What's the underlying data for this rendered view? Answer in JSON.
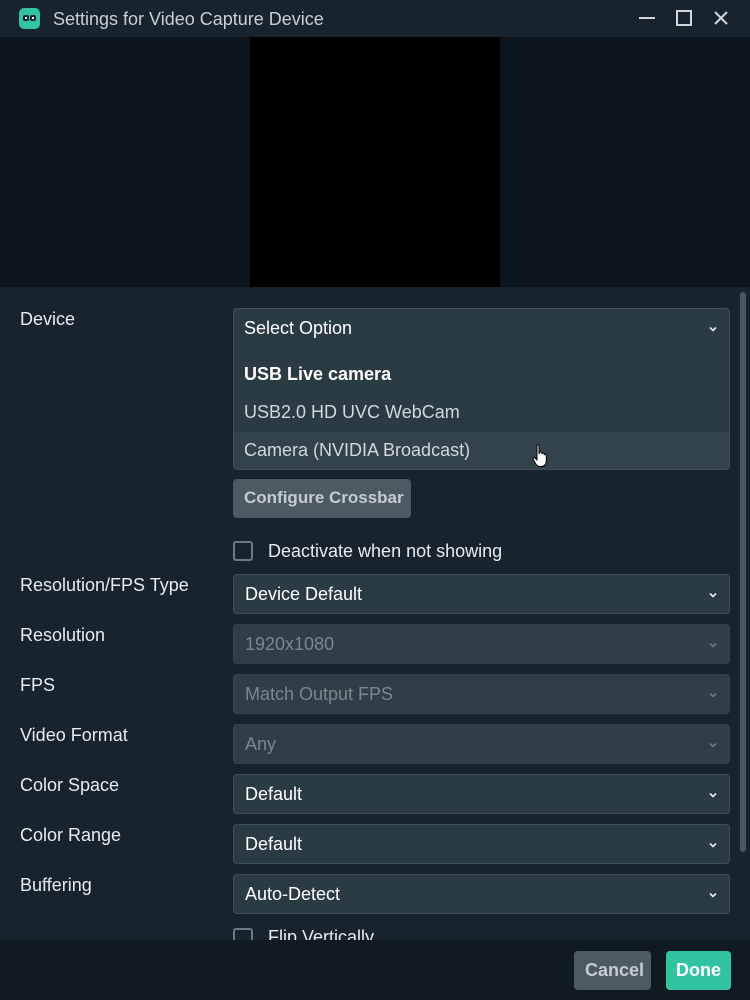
{
  "window": {
    "title": "Settings for Video Capture Device",
    "icons": [
      "app-logo-icon",
      "minimize-icon",
      "maximize-icon",
      "close-icon"
    ]
  },
  "colors": {
    "background": "#17242d",
    "preview_bg": "#0c151c",
    "field_bg": "#2b3b44",
    "accent": "#31c3a2",
    "secondary_button": "#4c5a62"
  },
  "settings": {
    "device": {
      "label": "Device",
      "placeholder": "Select Option",
      "options": [
        "USB Live camera",
        "USB2.0 HD UVC WebCam",
        "Camera (NVIDIA Broadcast)"
      ],
      "highlighted_option": "Camera (NVIDIA Broadcast)"
    },
    "configure_crossbar": "Configure Crossbar",
    "deactivate_when_not_showing": {
      "label": "Deactivate when not showing",
      "checked": false
    },
    "resolution_fps_type": {
      "label": "Resolution/FPS Type",
      "value": "Device Default"
    },
    "resolution": {
      "label": "Resolution",
      "value": "1920x1080",
      "disabled": true
    },
    "fps": {
      "label": "FPS",
      "value": "Match Output FPS",
      "disabled": true
    },
    "video_format": {
      "label": "Video Format",
      "value": "Any",
      "disabled": true
    },
    "color_space": {
      "label": "Color Space",
      "value": "Default"
    },
    "color_range": {
      "label": "Color Range",
      "value": "Default"
    },
    "buffering": {
      "label": "Buffering",
      "value": "Auto-Detect"
    },
    "flip_vertically": {
      "label": "Flip Vertically",
      "checked": false
    }
  },
  "footer": {
    "cancel_label": "Cancel",
    "done_label": "Done"
  }
}
